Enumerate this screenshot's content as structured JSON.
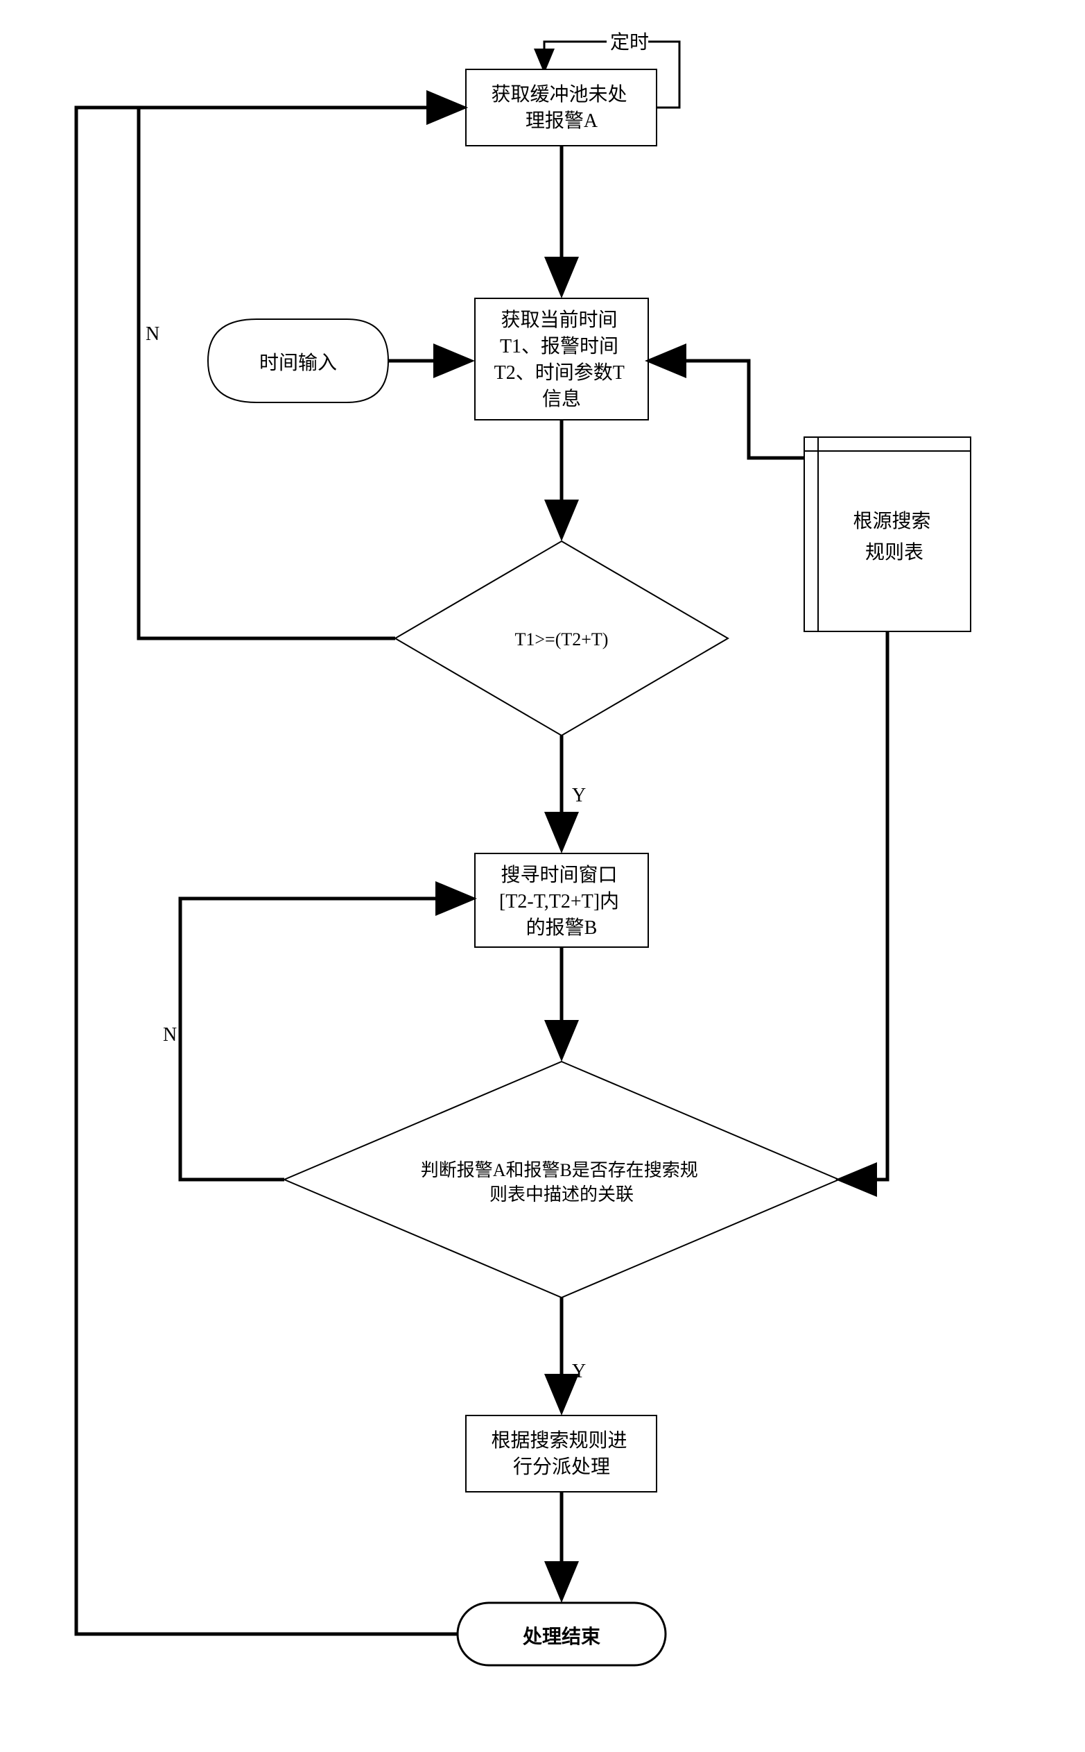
{
  "flowchart": {
    "timer_label": "定时",
    "step1": "获取缓冲池未处\n理报警A",
    "time_input": "时间输入",
    "step2": "获取当前时间\nT1、报警时间\nT2、时间参数T\n信息",
    "rules_table": "根源搜索\n规则表",
    "decision1": "T1>=(T2+T)",
    "step3": "搜寻时间窗口\n[T2-T,T2+T]内\n的报警B",
    "decision2": "判断报警A和报警B是否存在搜索规\n则表中描述的关联",
    "step4": "根据搜索规则进\n行分派处理",
    "end": "处理结束",
    "yes": "Y",
    "no": "N"
  }
}
